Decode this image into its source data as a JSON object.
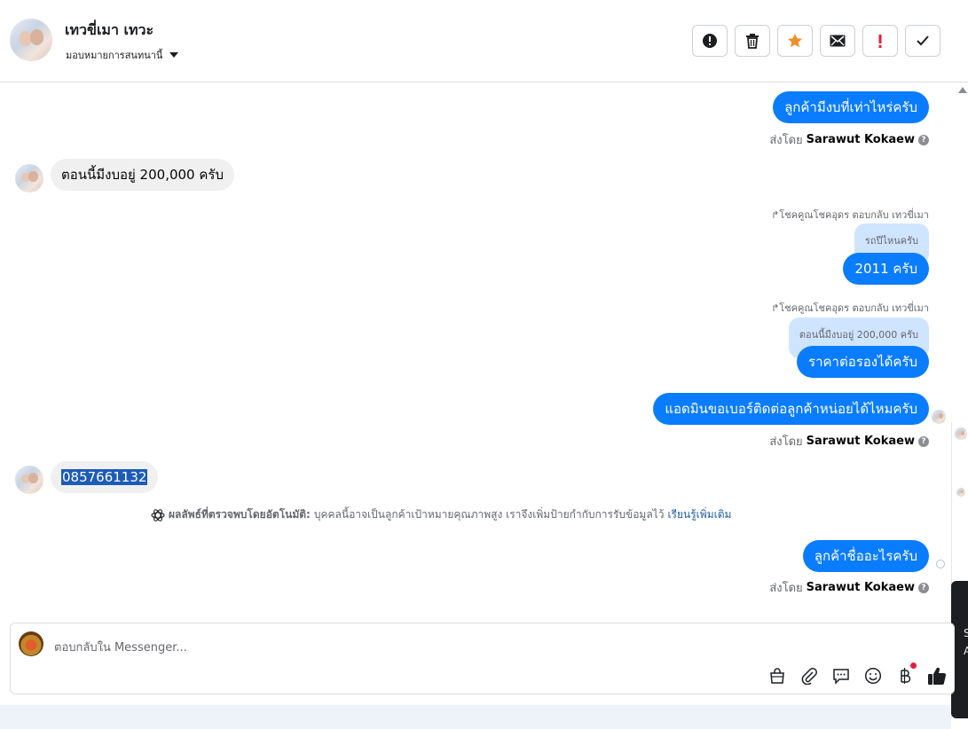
{
  "contact": {
    "name": "เทวขี่เมา เทวะ",
    "assign_label": "มอบหมายการสนทนานี้"
  },
  "toolbar": {
    "buttons": [
      {
        "icon": "alert-circle-icon"
      },
      {
        "icon": "trash-icon"
      },
      {
        "icon": "star-icon",
        "color": "#f28c28"
      },
      {
        "icon": "mail-icon"
      },
      {
        "icon": "exclamation-icon",
        "color": "#e41e3f"
      },
      {
        "icon": "check-icon"
      }
    ]
  },
  "messages": {
    "m1": {
      "text": "ลูกค้ามีงบที่เท่าไหร่ครับ"
    },
    "m1_sentby_prefix": "ส่งโดย",
    "m1_sender": "Sarawut Kokaew",
    "m2": {
      "text": "ตอนนี้มีงบอยู่ 200,000 ครับ"
    },
    "m3_meta": "↱โชคคูณโชคอุดร ตอบกลับ เทวขี่เมา",
    "m3_quote": "รถปีไหนครับ",
    "m3": {
      "text": "2011 ครับ"
    },
    "m4_meta": "↱โชคคูณโชคอุดร ตอบกลับ เทวขี่เมา",
    "m4_quote": "ตอนนี้มีงบอยู่ 200,000 ครับ",
    "m4": {
      "text": "ราคาต่อรองได้ครับ"
    },
    "m5": {
      "text": "แอดมินขอเบอร์ติดต่อลูกค้าหน่อยได้ไหมครับ"
    },
    "m5_sentby_prefix": "ส่งโดย",
    "m5_sender": "Sarawut Kokaew",
    "m6": {
      "text": "0857661132"
    },
    "auto_label": "ผลลัพธ์ที่ตรวจพบโดยอัตโนมัติ:",
    "auto_text": "บุคคลนี้อาจเป็นลูกค้าเป้าหมายคุณภาพสูง เราจึงเพิ่มป้ายกำกับการรับข้อมูลไว้",
    "auto_link": "เรียนรู้เพิ่มเติม",
    "m7": {
      "text": "ลูกค้าชื่ออะไรครับ"
    },
    "m7_sentby_prefix": "ส่งโดย",
    "m7_sender": "Sarawut Kokaew"
  },
  "composer": {
    "placeholder": "ตอบกลับใน Messenger...",
    "icons": [
      "shopping-bag-icon",
      "paperclip-icon",
      "saved-reply-icon",
      "emoji-icon",
      "baht-icon",
      "thumbs-up-icon"
    ]
  },
  "side_panel": {
    "line1": "S",
    "line2": "A"
  }
}
